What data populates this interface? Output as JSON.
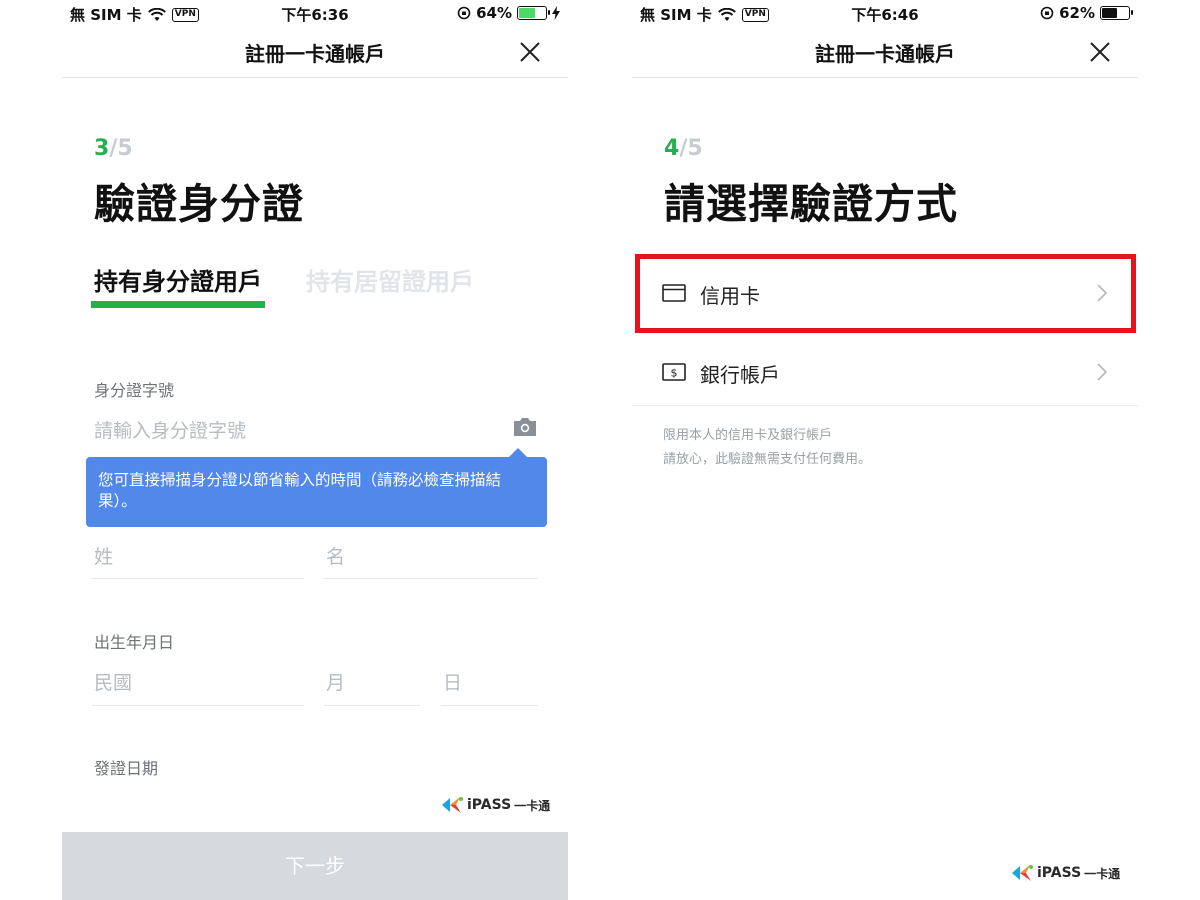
{
  "left": {
    "status": {
      "carrier": "無 SIM 卡",
      "vpn": "VPN",
      "time": "下午6:36",
      "battery": "64%",
      "battery_level": 0.64,
      "battery_color": "#4cd964"
    },
    "nav": {
      "title": "註冊一卡通帳戶"
    },
    "step": {
      "current": "3",
      "sep": "/",
      "total": "5"
    },
    "title": "驗證身分證",
    "tabs": [
      "持有身分證用戶",
      "持有居留證用戶"
    ],
    "id_field": {
      "label": "身分證字號",
      "placeholder": "請輸入身分證字號"
    },
    "tooltip": "您可直接掃描身分證以節省輸入的時間（請務必檢查掃描結果）。",
    "name_fields": {
      "surname": "姓",
      "given": "名"
    },
    "birth": {
      "label": "出生年月日",
      "year": "民國",
      "month": "月",
      "day": "日"
    },
    "issue_date": {
      "label": "發證日期"
    },
    "logo": {
      "brand": "iPASS",
      "suffix": "一卡通"
    },
    "next_button": "下一步"
  },
  "right": {
    "status": {
      "carrier": "無 SIM 卡",
      "vpn": "VPN",
      "time": "下午6:46",
      "battery": "62%",
      "battery_level": 0.62,
      "battery_color": "#111111"
    },
    "nav": {
      "title": "註冊一卡通帳戶"
    },
    "step": {
      "current": "4",
      "sep": "/",
      "total": "5"
    },
    "title": "請選擇驗證方式",
    "options": [
      {
        "label": "信用卡",
        "icon": "credit-card-icon"
      },
      {
        "label": "銀行帳戶",
        "icon": "bank-note-icon"
      }
    ],
    "notes": [
      "限用本人的信用卡及銀行帳戶",
      "請放心，此驗證無需支付任何費用。"
    ],
    "logo": {
      "brand": "iPASS",
      "suffix": "一卡通"
    },
    "highlight_color": "#e4141a"
  }
}
